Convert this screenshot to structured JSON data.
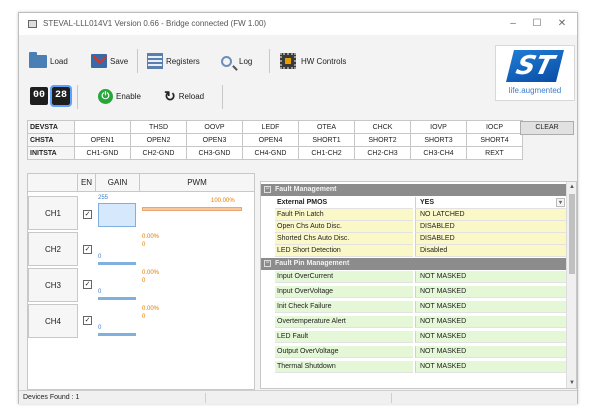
{
  "window": {
    "title": "STEVAL-LLL014V1 Version 0.66 - Bridge connected (FW 1.00)",
    "controls": {
      "minimize": "–",
      "maximize": "☐",
      "close": "✕"
    }
  },
  "toolbar": {
    "load": "Load",
    "save": "Save",
    "registers": "Registers",
    "log": "Log",
    "hw_controls": "HW Controls",
    "device_digits": [
      "00",
      "28"
    ],
    "enable": "Enable",
    "reload": "Reload",
    "enable_icon": "power-icon",
    "reload_icon": "reload-icon"
  },
  "logo": {
    "mark": "ST",
    "tagline": "life.augmented"
  },
  "status_table": {
    "rows": [
      {
        "label": "DEVSTA",
        "cells": [
          "",
          "THSD",
          "OOVP",
          "LEDF",
          "OTEA",
          "CHCK",
          "IOVP",
          "IOCP"
        ]
      },
      {
        "label": "CHSTA",
        "cells": [
          "OPEN1",
          "OPEN2",
          "OPEN3",
          "OPEN4",
          "SHORT1",
          "SHORT2",
          "SHORT3",
          "SHORT4"
        ]
      },
      {
        "label": "INITSTA",
        "cells": [
          "CH1-GND",
          "CH2-GND",
          "CH3-GND",
          "CH4-GND",
          "CH1-CH2",
          "CH2-CH3",
          "CH3-CH4",
          "REXT"
        ]
      }
    ],
    "clear": "CLEAR"
  },
  "channels": {
    "headers": {
      "en": "EN",
      "gain": "GAIN",
      "pwm": "PWM"
    },
    "items": [
      {
        "label": "CH1",
        "enabled": true,
        "gain": "255",
        "gain_fraction": 1.0,
        "pwm": "100.00%",
        "pwm_fraction": 1.0
      },
      {
        "label": "CH2",
        "enabled": true,
        "gain": "0",
        "gain_fraction": 0.0,
        "pwm": "0.00%",
        "pwm_sub": "0",
        "pwm_fraction": 0.0
      },
      {
        "label": "CH3",
        "enabled": true,
        "gain": "0",
        "gain_fraction": 0.0,
        "pwm": "0.00%",
        "pwm_sub": "0",
        "pwm_fraction": 0.0
      },
      {
        "label": "CH4",
        "enabled": true,
        "gain": "0",
        "gain_fraction": 0.0,
        "pwm": "0.00%",
        "pwm_sub": "0",
        "pwm_fraction": 0.0
      }
    ]
  },
  "properties": {
    "fault_management": {
      "title": "Fault Management",
      "rows": [
        {
          "key": "External PMOS",
          "value": "YES"
        },
        {
          "key": "Fault Pin Latch",
          "value": "NO LATCHED"
        },
        {
          "key": "Open Chs Auto Disc.",
          "value": "DISABLED"
        },
        {
          "key": "Shorted Chs Auto Disc.",
          "value": "DISABLED"
        },
        {
          "key": "LED Short Detection",
          "value": "Disabled"
        }
      ]
    },
    "fault_pin_management": {
      "title": "Fault Pin Management",
      "rows": [
        {
          "key": "Input OverCurrent",
          "value": "NOT MASKED"
        },
        {
          "key": "Input OverVoltage",
          "value": "NOT MASKED"
        },
        {
          "key": "Init Check Failure",
          "value": "NOT MASKED"
        },
        {
          "key": "Overtemperature Alert",
          "value": "NOT MASKED"
        },
        {
          "key": "LED Fault",
          "value": "NOT MASKED"
        },
        {
          "key": "Output OverVoltage",
          "value": "NOT MASKED"
        },
        {
          "key": "Thermal Shutdown",
          "value": "NOT MASKED"
        }
      ]
    }
  },
  "status_bar": {
    "text": "Devices Found : 1"
  },
  "colors": {
    "accent": "#1f7bd3",
    "yellow_row": "#fbf8c8",
    "green_row": "#e4f7d6",
    "category": "#8c8c8c"
  }
}
